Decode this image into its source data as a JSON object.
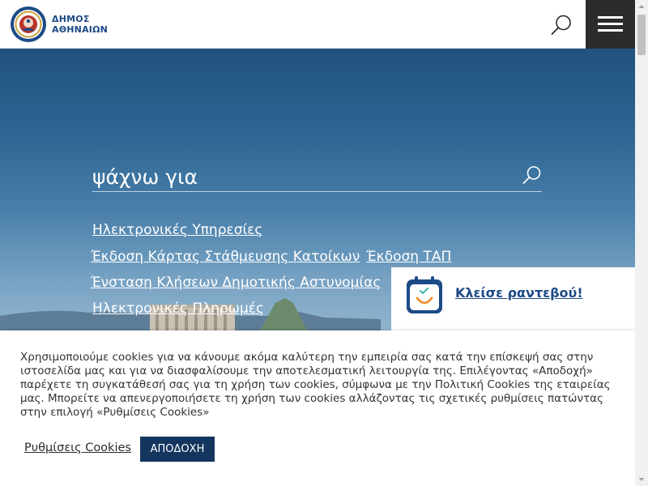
{
  "header": {
    "logo_line1": "ΔΗΜΟΣ",
    "logo_line2": "ΑΘΗΝΑΙΩΝ",
    "search_icon": "search-icon",
    "menu_icon": "hamburger-menu-icon"
  },
  "hero": {
    "search_placeholder": "ψάχνω για",
    "links": [
      "Ηλεκτρονικές Υπηρεσίες",
      "Έκδοση Κάρτας Στάθμευσης Κατοίκων",
      "Έκδοση ΤΑΠ",
      "Ένσταση Κλήσεων Δημοτικής Αστυνομίας",
      "Ηλεκτρονικές Πληρωμές"
    ]
  },
  "appointment": {
    "label": "Κλείσε ραντεβού!",
    "icon": "calendar-smile-icon"
  },
  "cookie": {
    "text": "Χρησιμοποιούμε cookies για να κάνουμε ακόμα καλύτερη την εμπειρία σας κατά την επίσκεψή σας στην ιστοσελίδα μας και για να διασφαλίσουμε την αποτελεσματική λειτουργία της. Επιλέγοντας «Αποδοχή» παρέχετε τη συγκατάθεσή σας για τη χρήση των cookies, σύμφωνα με την Πολιτική Cookies της εταιρείας μας. Μπορείτε να απενεργοποιήσετε τη χρήση των cookies αλλάζοντας τις σχετικές ρυθμίσεις πατώντας στην επιλογή «Ρυθμίσεις Cookies»",
    "settings_label": "Ρυθμίσεις Cookies",
    "accept_label": "ΑΠΟΔΟΧΗ"
  },
  "colors": {
    "brand": "#1c4a86",
    "accept_button": "#14365e",
    "menu_button": "#2b2b2b"
  }
}
